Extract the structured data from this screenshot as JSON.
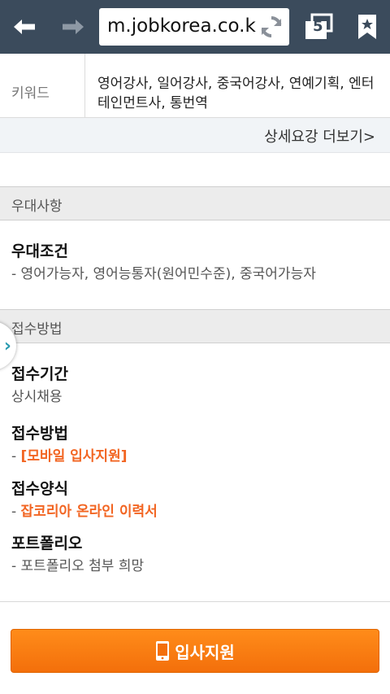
{
  "browser": {
    "url": "m.jobkorea.co.kr",
    "tab_count": "5"
  },
  "detail": {
    "keyword_label": "키워드",
    "keyword_value": "영어강사, 일어강사, 중국어강사, 연예기획, 엔터테인먼트사, 통번역",
    "more_link": "상세요강 더보기>"
  },
  "preferences": {
    "header": "우대사항",
    "condition_title": "우대조건",
    "condition_value": "- 영어가능자, 영어능통자(원어민수준), 중국어가능자"
  },
  "application": {
    "header": "접수방법",
    "period_title": "접수기간",
    "period_value": "상시채용",
    "method_title": "접수방법",
    "method_prefix": "- ",
    "method_value": "[모바일 입사지원]",
    "form_title": "접수양식",
    "form_prefix": "- ",
    "form_value": "잡코리아 온라인 이력서",
    "portfolio_title": "포트폴리오",
    "portfolio_value": "- 포트폴리오 첨부 희망"
  },
  "apply_button": "입사지원",
  "colors": {
    "toolbar": "#3b4b5c",
    "accent_orange": "#f26522",
    "section_header_bg": "#ececec"
  }
}
